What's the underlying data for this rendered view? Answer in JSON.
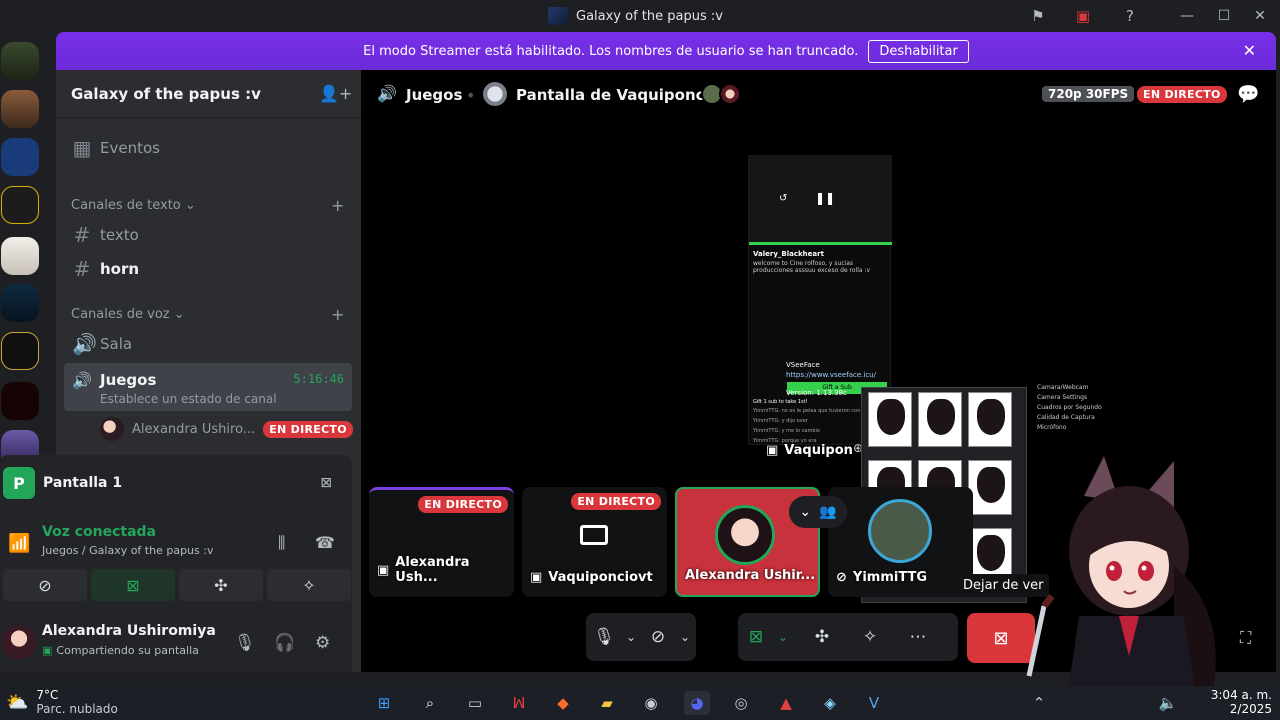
{
  "window": {
    "title": "Galaxy of the papus :v"
  },
  "banner": {
    "text": "El modo Streamer está habilitado. Los nombres de usuario se han truncado.",
    "button": "Deshabilitar"
  },
  "server": {
    "name": "Galaxy of the papus :v"
  },
  "sidebar": {
    "events": "Eventos",
    "text_category": "Canales de texto",
    "text_channels": [
      "texto",
      "horn"
    ],
    "voice_category": "Canales de voz",
    "voice_channels": [
      "Sala"
    ],
    "active_voice": {
      "name": "Juegos",
      "timer": "5:16:46",
      "status": "Establece un estado de canal",
      "user": "Alexandra Ushiro...",
      "live": "EN DIRECTO"
    }
  },
  "panel": {
    "screen_letter": "P",
    "screen_name": "Pantalla 1",
    "connection_title": "Voz conectada",
    "connection_sub": "Juegos / Galaxy of the papus :v"
  },
  "user": {
    "name": "Alexandra Ushiromiya",
    "status": "Compartiendo su pantalla"
  },
  "stage": {
    "channel": "Juegos",
    "stream_title": "Pantalla de Vaquiponciovt",
    "quality": "720p 30FPS",
    "live": "EN DIRECTO",
    "shared": {
      "username": "Valery_Blackheart",
      "desc": "welcome to Cine rolfoso, y sucias producciones asssuu exceso de rolla :v",
      "sub_button": "Gift a Sub",
      "gift_line": "Gift 1 sub to take 1st!",
      "chat_lines": [
        "YimmiTTG: no es le pelea que tuvieron con madara",
        "YimmiTTG: y dijo ever",
        "YimmiTTG: y me lo cambio",
        "YimmiTTG: porque yo era",
        "VSeeFace",
        "https://www.vseeface.icu/",
        "Version: 1.13.38c"
      ],
      "stream_label": "Vaquipon"
    },
    "settings_lines": [
      "Camara/Webcam",
      "Camera Settings",
      "Cuadros por Segundo",
      "Calidad de Captura",
      "Micrófono"
    ],
    "tiles": [
      {
        "label": "Alexandra Ush...",
        "live": "EN DIRECTO"
      },
      {
        "label": "Vaquiponciovt",
        "live": "EN DIRECTO"
      },
      {
        "label": "Alexandra Ushir...",
        "live": ""
      },
      {
        "label": "YimmiTTG",
        "live": ""
      }
    ],
    "tooltip": "Dejar de ver"
  },
  "taskbar": {
    "temp": "7°C",
    "condition": "Parc. nublado",
    "time": "3:04 a. m.",
    "date": "2/2025"
  },
  "colors": {
    "accent": "#5865f2",
    "banner": "#6a2bd8",
    "live": "#da373c",
    "green": "#23a55a"
  }
}
